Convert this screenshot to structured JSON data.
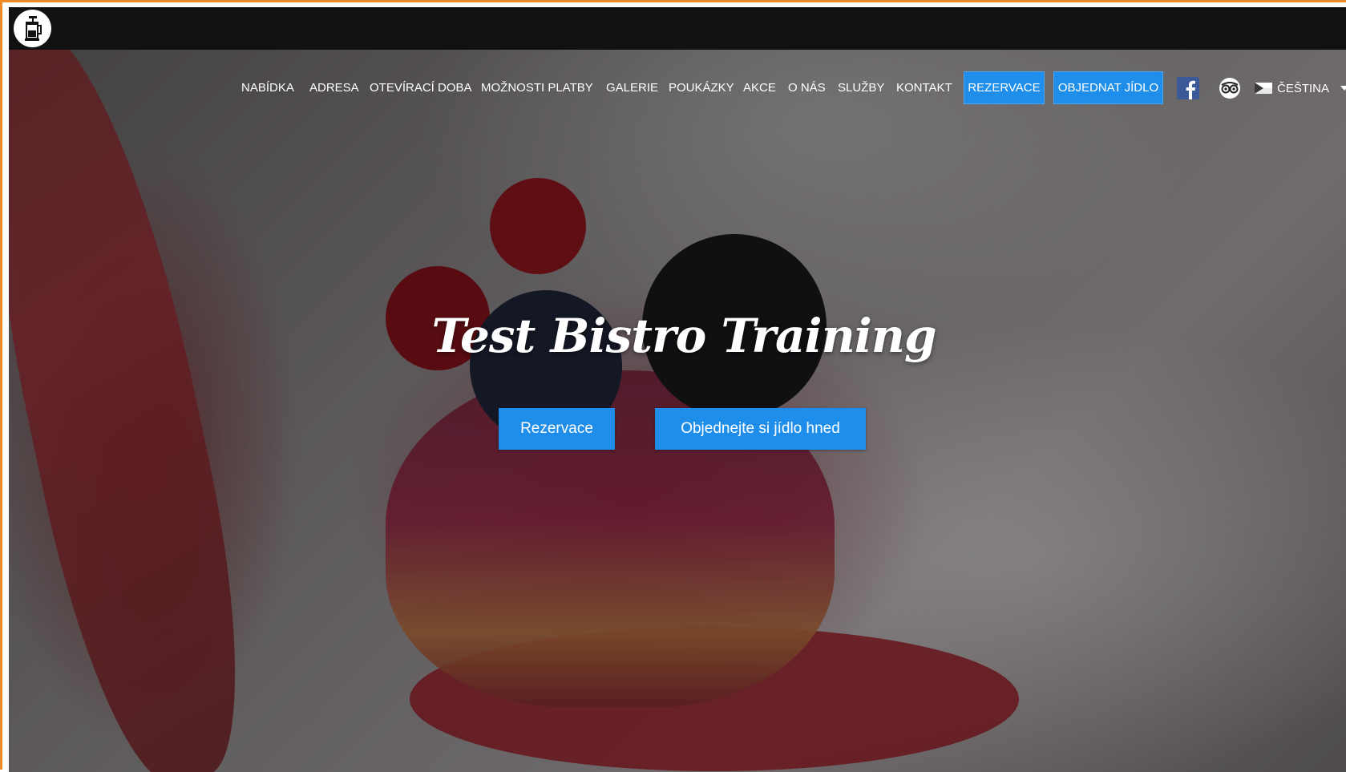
{
  "site": {
    "title": "Test Bistro Training"
  },
  "nav": {
    "items": [
      {
        "label": "NABÍDKA"
      },
      {
        "label": "ADRESA"
      },
      {
        "label": "OTEVÍRACÍ DOBA"
      },
      {
        "label": "MOŽNOSTI PLATBY"
      },
      {
        "label": "GALERIE"
      },
      {
        "label": "POUKÁZKY"
      },
      {
        "label": "AKCE"
      },
      {
        "label": "O NÁS"
      },
      {
        "label": "SLUŽBY"
      },
      {
        "label": "KONTAKT"
      }
    ],
    "reservation_label": "REZERVACE",
    "order_label": "OBJEDNAT JÍDLO",
    "language_label": "ČEŠTINA"
  },
  "hero": {
    "reservation_cta": "Rezervace",
    "order_cta": "Objednejte si jídlo hned"
  },
  "icons": {
    "logo": "french-press-icon",
    "facebook": "facebook-icon",
    "tripadvisor": "tripadvisor-icon",
    "flag": "czech-flag-icon",
    "dropdown": "chevron-down-icon"
  },
  "colors": {
    "accent": "#1e8eea",
    "topbar": "#111111",
    "frame": "#f08a24",
    "facebook": "#3b5998"
  }
}
